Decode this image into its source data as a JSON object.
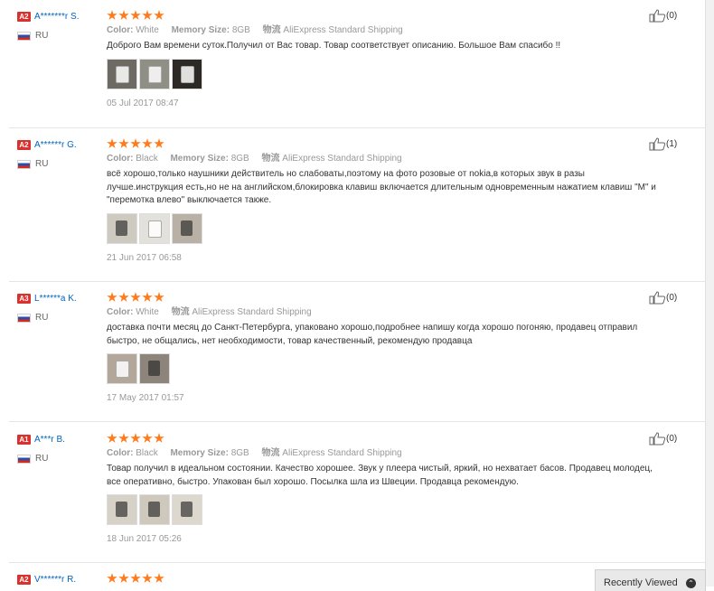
{
  "reviews": [
    {
      "level": "A2",
      "name": "A*******r S.",
      "country": "RU",
      "color_label": "Color:",
      "color": "White",
      "memory_label": "Memory Size:",
      "memory": "8GB",
      "ship_label": "物流",
      "shipping": "AliExpress Standard Shipping",
      "text": "Доброго Вам времени суток.Получил от Вас товар. Товар соответствует описанию. Большое Вам спасибо !!",
      "photos": [
        "white",
        "white",
        "dark"
      ],
      "date": "05 Jul 2017 08:47",
      "helpful": "(0)"
    },
    {
      "level": "A2",
      "name": "A******r G.",
      "country": "RU",
      "color_label": "Color:",
      "color": "Black",
      "memory_label": "Memory Size:",
      "memory": "8GB",
      "ship_label": "物流",
      "shipping": "AliExpress Standard Shipping",
      "text": "всё хорошо,только наушники действитель но слабоваты,поэтому на фото розовые от nokia,в которых звук в разы лучше.инструкция есть,но не на английском,блокировка клавиш включается длительным одновременным нажатием клавиш \"M\" и \"перемотка влево\" выключается также.",
      "photos": [
        "dark",
        "white",
        "dark"
      ],
      "date": "21 Jun 2017 06:58",
      "helpful": "(1)"
    },
    {
      "level": "A3",
      "name": "L******a K.",
      "country": "RU",
      "color_label": "Color:",
      "color": "White",
      "memory_label": "",
      "memory": "",
      "ship_label": "物流",
      "shipping": "AliExpress Standard Shipping",
      "text": "доставка почти месяц до Санкт-Петербурга, упаковано хорошо,подробнее напишу когда хорошо погоняю, продавец отправил быстро, не общались, нет необходимости, товар качественный, рекомендую продавца",
      "photos": [
        "white",
        "dark"
      ],
      "date": "17 May 2017 01:57",
      "helpful": "(0)"
    },
    {
      "level": "A1",
      "name": "A***r B.",
      "country": "RU",
      "color_label": "Color:",
      "color": "Black",
      "memory_label": "Memory Size:",
      "memory": "8GB",
      "ship_label": "物流",
      "shipping": "AliExpress Standard Shipping",
      "text": "Товар получил в идеальном состоянии. Качество хорошее. Звук у плеера чистый, яркий, но нехватает басов. Продавец молодец, все оперативно, быстро. Упакован был хорошо. Посылка шла из Швеции. Продавца рекомендую.",
      "photos": [
        "dark",
        "dark",
        "dark"
      ],
      "date": "18 Jun 2017 05:26",
      "helpful": "(0)"
    },
    {
      "level": "A2",
      "name": "V******r R.",
      "country": "",
      "color_label": "",
      "color": "",
      "memory_label": "",
      "memory": "",
      "ship_label": "",
      "shipping": "",
      "text": "",
      "photos": [],
      "date": "",
      "helpful": ""
    }
  ],
  "recently_viewed": {
    "label": "Recently Viewed",
    "icon": "chevron-up-icon"
  },
  "colors": {
    "accent_star": "#ff7a1a",
    "badge": "#d9322e",
    "user_link": "#0066c0"
  }
}
